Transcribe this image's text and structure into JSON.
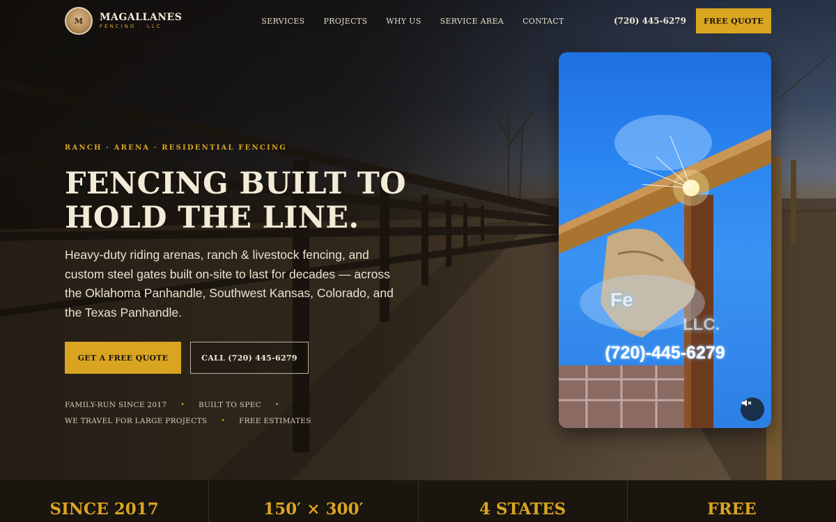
{
  "header": {
    "logo_badge_text": "M",
    "logo_name": "MAGALLANES",
    "logo_sub": "FENCING · LLC",
    "nav": [
      {
        "label": "SERVICES"
      },
      {
        "label": "PROJECTS"
      },
      {
        "label": "WHY US"
      },
      {
        "label": "SERVICE AREA"
      },
      {
        "label": "CONTACT"
      }
    ],
    "phone": "(720) 445-6279",
    "cta_label": "FREE QUOTE"
  },
  "hero": {
    "eyebrow": "RANCH · ARENA · RESIDENTIAL FENCING",
    "headline_line1": "FENCING BUILT TO",
    "headline_line2": "HOLD THE LINE.",
    "lede": "Heavy-duty riding arenas, ranch & livestock fencing, and custom steel gates built on-site to last for decades — across the Oklahoma Panhandle, Southwest Kansas, Colorado, and the Texas Panhandle.",
    "primary_button": "GET A FREE QUOTE",
    "secondary_button": "CALL (720) 445-6279",
    "trust_points": [
      "FAMILY-RUN SINCE 2017",
      "BUILT TO SPEC",
      "WE TRAVEL FOR LARGE PROJECTS",
      "FREE ESTIMATES"
    ]
  },
  "video": {
    "overlay_text_1": "Fe",
    "overlay_text_2": "LLC.",
    "phone_text": "(720)-445-6279",
    "mute_icon": "muted-speaker-icon"
  },
  "stats": [
    {
      "value": "SINCE 2017"
    },
    {
      "value": "150′ × 300′"
    },
    {
      "value": "4 STATES"
    },
    {
      "value": "FREE"
    }
  ],
  "colors": {
    "accent": "#d9a521",
    "dark": "#1b150f",
    "text": "#f3ead8"
  }
}
